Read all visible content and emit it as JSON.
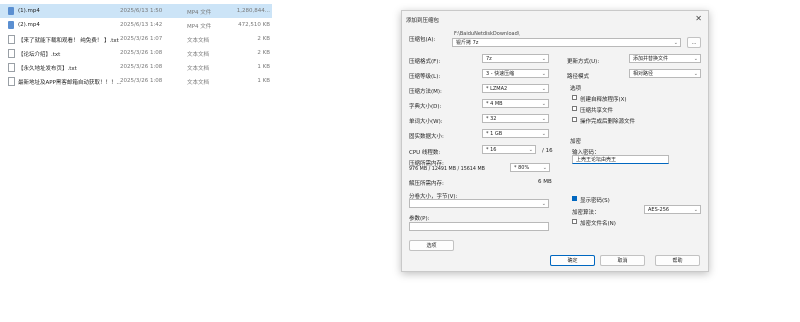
{
  "files": [
    {
      "name": "(1).mp4",
      "date": "2025/6/13 1:50",
      "type": "MP4 文件",
      "size": "1,280,844...",
      "icon": "video-file-icon",
      "selected": true
    },
    {
      "name": "(2).mp4",
      "date": "2025/6/13 1:42",
      "type": "MP4 文件",
      "size": "472,510 KB",
      "icon": "video-file-icon",
      "selected": false
    },
    {
      "name": "【来了就能下载和观看！ 纯免费！ 】.txt",
      "date": "2025/3/26 1:07",
      "type": "文本文档",
      "size": "2 KB",
      "icon": "text-file-icon",
      "selected": false
    },
    {
      "name": "【论坛介绍】.txt",
      "date": "2025/3/26 1:08",
      "type": "文本文档",
      "size": "2 KB",
      "icon": "text-file-icon",
      "selected": false
    },
    {
      "name": "【永久地址发布页】.txt",
      "date": "2025/3/26 1:08",
      "type": "文本文档",
      "size": "1 KB",
      "icon": "text-file-icon",
      "selected": false
    },
    {
      "name": "最新地址及APP黑客邮箱自动获取！！！...",
      "date": "2025/3/26 1:08",
      "type": "文本文档",
      "size": "1 KB",
      "icon": "text-file-icon",
      "selected": false
    }
  ],
  "dialog": {
    "title": "添加到压缩包",
    "archive_label": "压缩包(A):",
    "archive_path": "F:\\BaiduNetdiskDownload\\",
    "archive_name": "锟斤拷 7z",
    "browse": "...",
    "format_label": "压缩格式(F):",
    "format_value": "7z",
    "level_label": "压缩等级(L):",
    "level_value": "3 - 快速压缩",
    "method_label": "压缩方法(M):",
    "method_value": "* LZMA2",
    "dict_label": "字典大小(D):",
    "dict_value": "* 4 MB",
    "word_label": "单词大小(W):",
    "word_value": "* 32",
    "solid_label": "固实数据大小:",
    "solid_value": "* 1 GB",
    "cpu_label": "CPU 线程数:",
    "cpu_value": "* 16",
    "cpu_max": "/ 16",
    "mem_label": "压缩所需内存:",
    "mem_detail": "976 MB / 12491 MB / 15614 MB",
    "mem_pct": "* 80%",
    "decomp_label": "解压所需内存:",
    "decomp_value": "6 MB",
    "split_label": "分卷大小，字节(V):",
    "params_label": "参数(P):",
    "options_button": "选项",
    "update_label": "更新方式(U):",
    "update_value": "添加并替换文件",
    "pathmode_label": "路径模式",
    "pathmode_value": "相对路径",
    "options_group": "选项",
    "opt_sfx": "创建自释放程序(X)",
    "opt_shared": "压缩共享文件",
    "opt_delete": "操作完成后删除源文件",
    "encryption_group": "加密",
    "pwd_label": "输入密码：",
    "pwd_value": "上壳王论坛由壳王",
    "show_pwd": "显示密码(S)",
    "enc_method_label": "加密算法：",
    "enc_method_value": "AES-256",
    "enc_names": "加密文件名(N)",
    "ok": "确定",
    "cancel": "取消",
    "help": "帮助"
  }
}
